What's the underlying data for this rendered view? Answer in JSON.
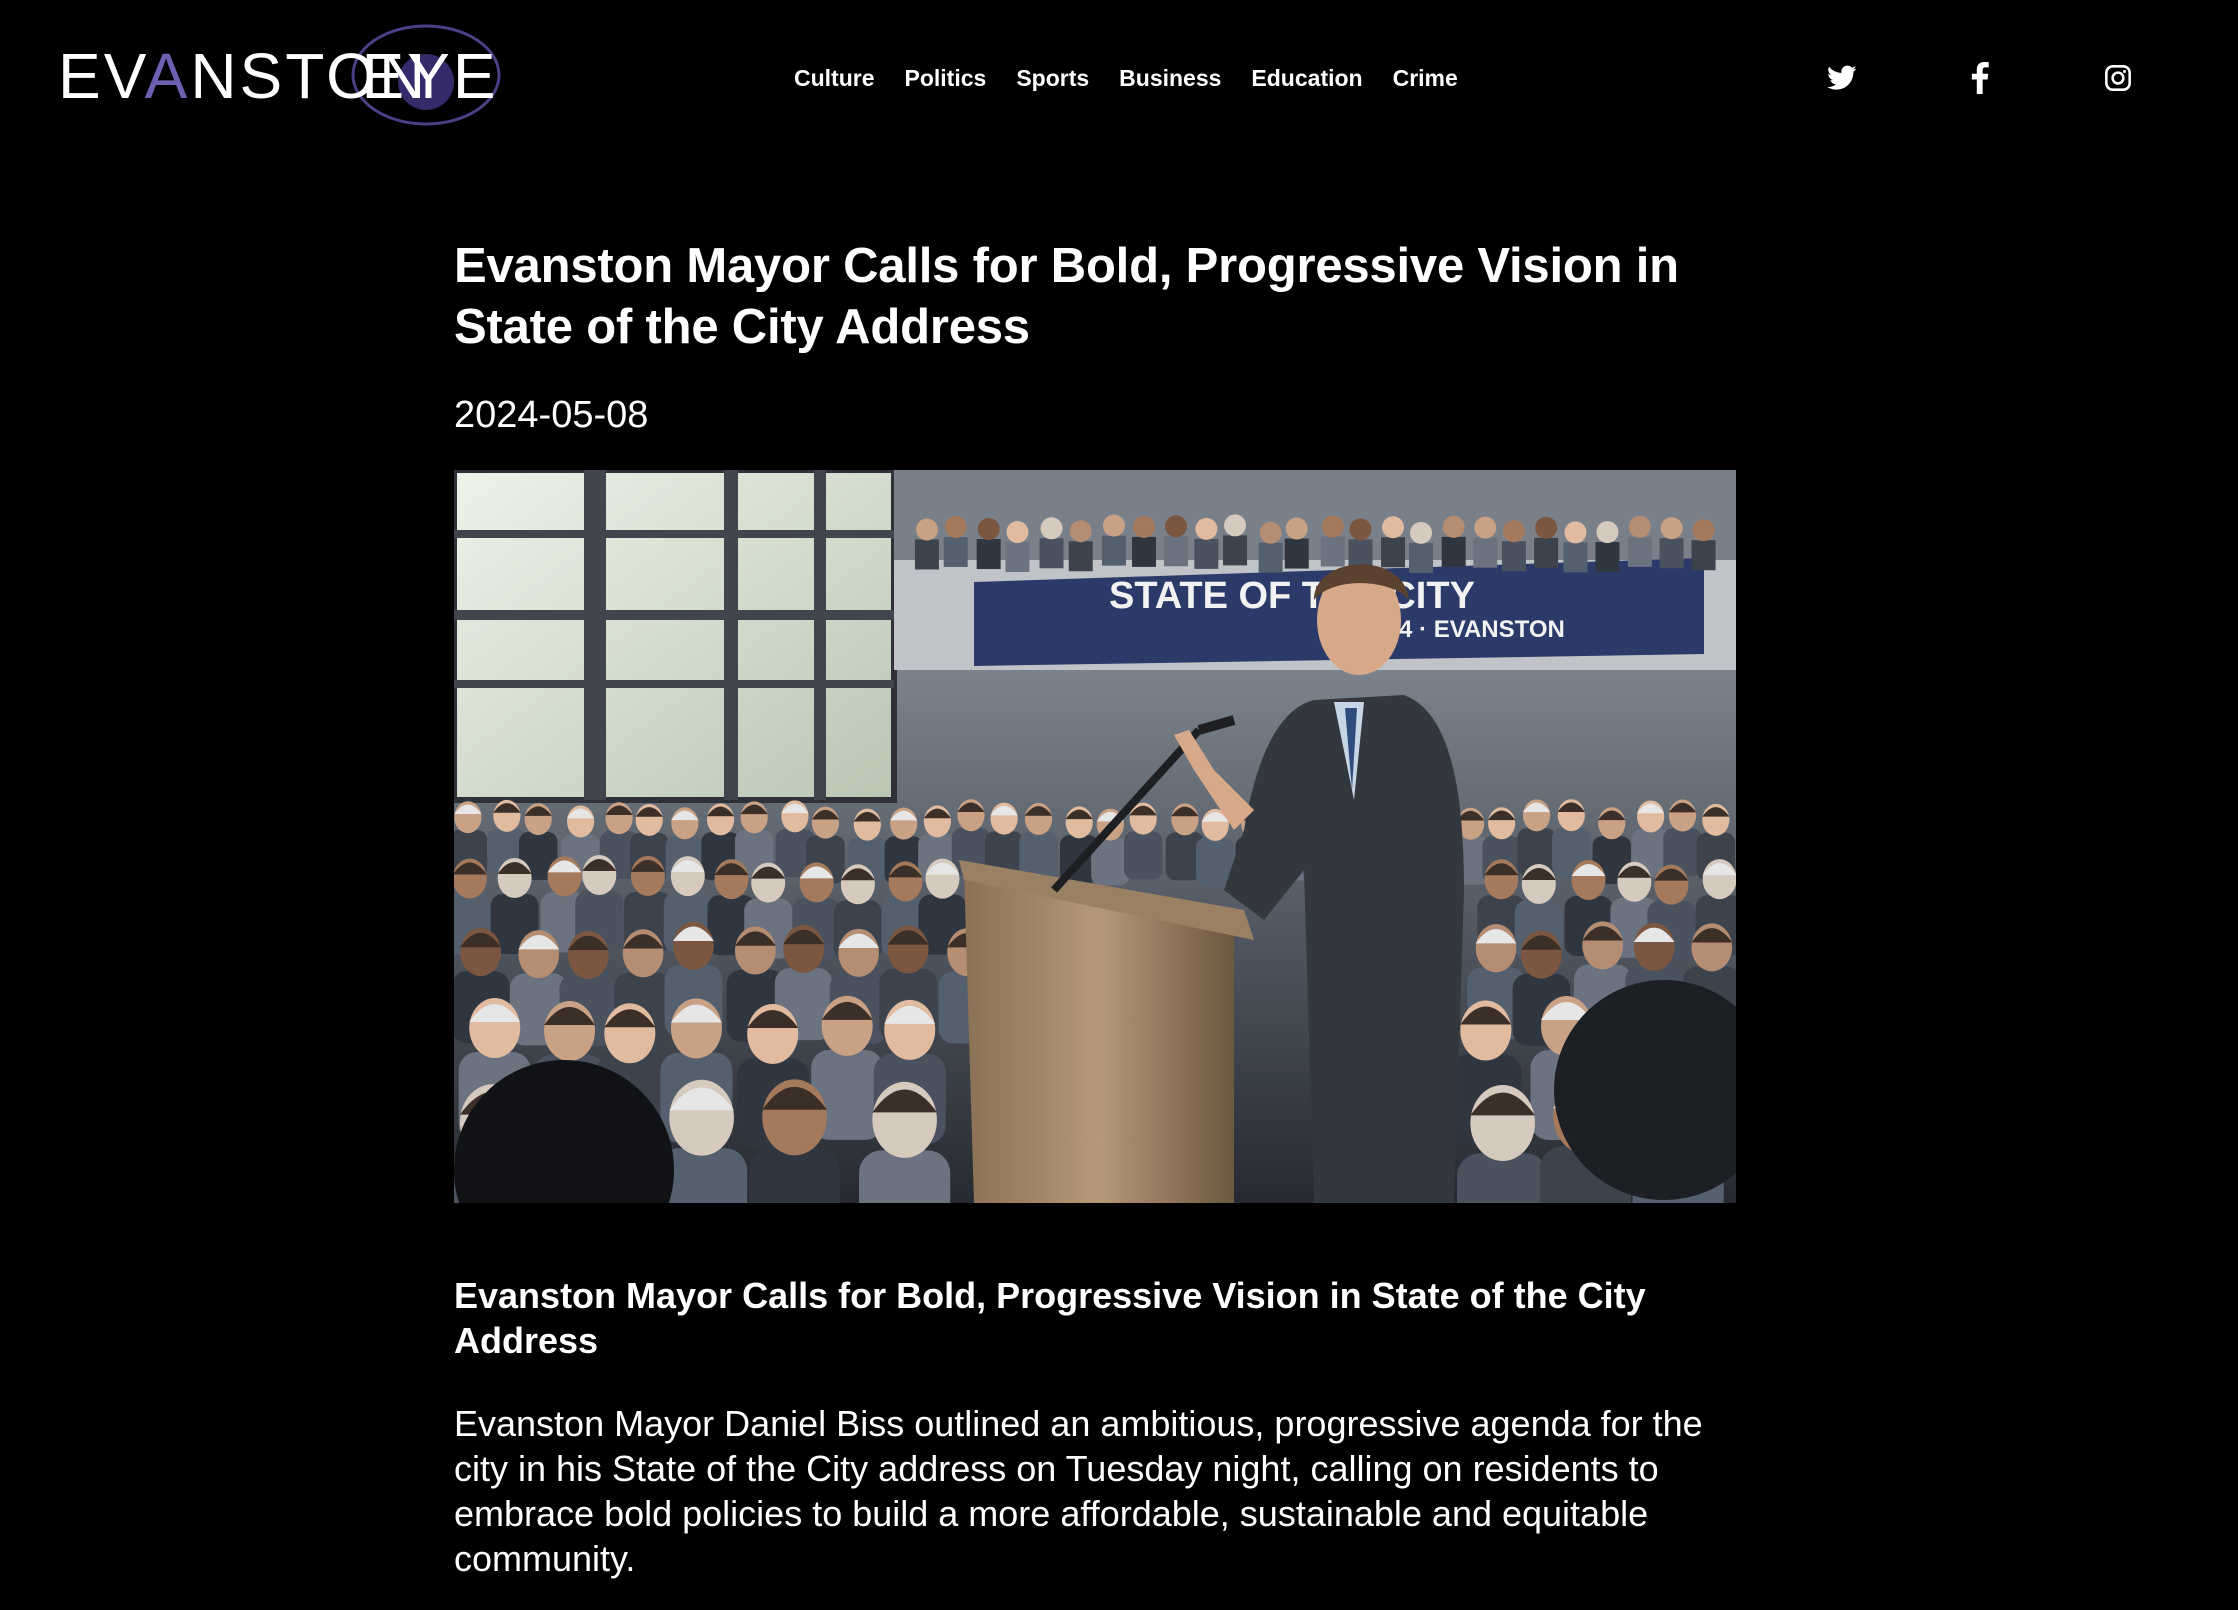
{
  "site": {
    "logo_text_part1": "EV",
    "logo_text_accent": "A",
    "logo_text_part2": "NSTON",
    "logo_text_part3": "EYE",
    "accent_color": "#6f5fb0"
  },
  "nav": {
    "items": [
      {
        "label": "Culture"
      },
      {
        "label": "Politics"
      },
      {
        "label": "Sports"
      },
      {
        "label": "Business"
      },
      {
        "label": "Education"
      },
      {
        "label": "Crime"
      }
    ]
  },
  "social": {
    "icons": [
      "twitter-icon",
      "facebook-icon",
      "instagram-icon"
    ]
  },
  "article": {
    "headline": "Evanston Mayor Calls for Bold, Progressive Vision in State of the City Address",
    "date": "2024-05-08",
    "image": {
      "banner_line1": "STATE OF THE CITY",
      "banner_line2": "2024 · EVANSTON"
    },
    "subheadline": "Evanston Mayor Calls for Bold, Progressive Vision in State of the City Address",
    "paragraph1": "Evanston Mayor Daniel Biss outlined an ambitious, progressive agenda for the city in his State of the City address on Tuesday night, calling on residents to embrace bold policies to build a more affordable, sustainable and equitable community."
  }
}
